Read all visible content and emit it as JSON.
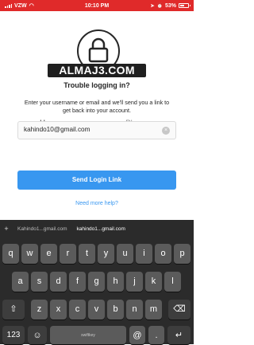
{
  "status_bar": {
    "carrier": "VZW",
    "time": "10:10 PM",
    "battery": "53%"
  },
  "watermark": "ALMAJ3.COM",
  "header": {
    "title": "Trouble logging in?",
    "description": "Enter your username or email and we'll send you a link to get back into your account."
  },
  "tabs": [
    {
      "label": "Username"
    },
    {
      "label": "Phone"
    }
  ],
  "input": {
    "value": "kahindo10@gmail.com"
  },
  "send_button_label": "Send Login Link",
  "help_link": "Need more help?",
  "keyboard": {
    "suggestions": [
      "Kahindo1...gmail.com",
      "kahindo1...gmail.com"
    ],
    "row1": [
      "q",
      "w",
      "e",
      "r",
      "t",
      "y",
      "u",
      "i",
      "o",
      "p"
    ],
    "row2": [
      "a",
      "s",
      "d",
      "f",
      "g",
      "h",
      "j",
      "k",
      "l"
    ],
    "row3": [
      "z",
      "x",
      "c",
      "v",
      "b",
      "n",
      "m"
    ],
    "num_key": "123",
    "at_key": "@",
    "space_label": "swiftkey"
  },
  "colors": {
    "status_bar": "#e02a2a",
    "accent": "#3897f0",
    "keyboard": "#2b2b2b"
  }
}
